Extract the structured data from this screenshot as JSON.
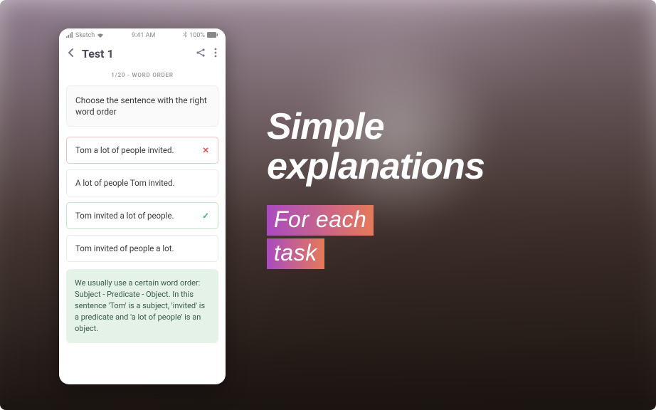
{
  "status_bar": {
    "carrier": "Sketch",
    "time": "9:41 AM",
    "battery": "100%"
  },
  "app_bar": {
    "title": "Test 1"
  },
  "progress": "1/20 - WORD ORDER",
  "question": "Choose the sentence with the right word order",
  "options": [
    {
      "text": "Tom a lot of people invited.",
      "state": "wrong"
    },
    {
      "text": "A lot of people Tom invited.",
      "state": "none"
    },
    {
      "text": "Tom invited a lot of people.",
      "state": "correct"
    },
    {
      "text": "Tom invited of people a lot.",
      "state": "none"
    }
  ],
  "explanation": "We usually use a certain word order: Subject - Predicate - Object. In this sentence 'Tom' is a subject, 'invited' is a predicate and 'a lot of people' is an object.",
  "promo": {
    "title_line1": "Simple",
    "title_line2": "explanations",
    "sub_line1": "For each",
    "sub_line2": "task"
  },
  "colors": {
    "gradient_start": "#a94bc0",
    "gradient_end": "#e57a5a",
    "correct": "#3cb26a",
    "wrong": "#e05555"
  }
}
